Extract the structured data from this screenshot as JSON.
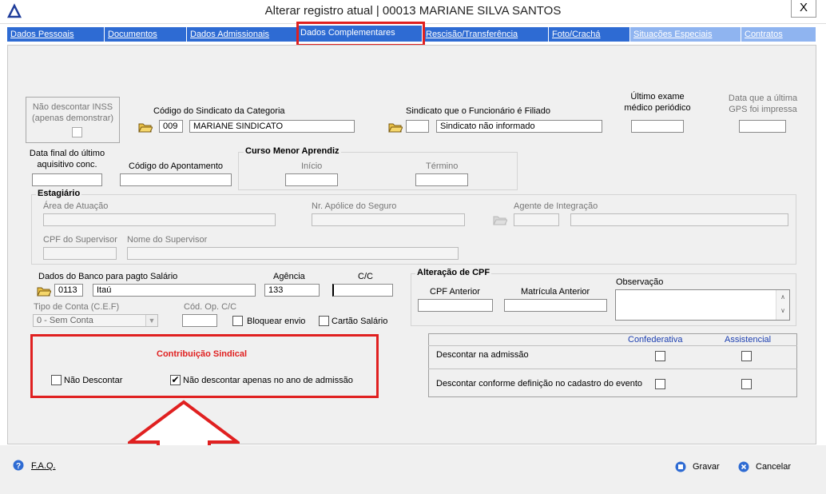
{
  "window": {
    "title": "Alterar registro atual | 00013 MARIANE SILVA SANTOS",
    "close": "X"
  },
  "tabs": [
    {
      "label": "Dados Pessoais"
    },
    {
      "label": "Documentos"
    },
    {
      "label": "Dados Admissionais"
    },
    {
      "label": "Dados Complementares"
    },
    {
      "label": "Rescisão/Transferência"
    },
    {
      "label": "Foto/Crachá"
    },
    {
      "label": "Situações Especiais"
    },
    {
      "label": "Contratos"
    }
  ],
  "inss": {
    "label_line1": "Não descontar INSS",
    "label_line2": "(apenas demonstrar)"
  },
  "sindicato_categoria": {
    "label": "Código do Sindicato da Categoria",
    "code": "009",
    "name": "MARIANE SINDICATO"
  },
  "sindicato_filiado": {
    "label": "Sindicato que o Funcionário é Filiado",
    "code": "",
    "name": "Sindicato não informado"
  },
  "ultimo_exame": {
    "label": "Último exame médico periódico",
    "value": ""
  },
  "gps": {
    "label": "Data que a última GPS foi impressa",
    "value": ""
  },
  "aquisitivo": {
    "label": "Data final do último aquisitivo conc.",
    "value": ""
  },
  "apontamento": {
    "label": "Código do Apontamento",
    "value": ""
  },
  "curso": {
    "title": "Curso Menor Aprendiz",
    "inicio_label": "Início",
    "termino_label": "Término"
  },
  "estagiario": {
    "title": "Estagiário",
    "area_label": "Área de Atuação",
    "apolice_label": "Nr. Apólice do Seguro",
    "agente_label": "Agente de Integração",
    "cpf_sup_label": "CPF do Supervisor",
    "nome_sup_label": "Nome do Supervisor"
  },
  "banco": {
    "label": "Dados do Banco para pagto Salário",
    "code": "0113",
    "name": "Itaú",
    "agencia_label": "Agência",
    "agencia": "133",
    "cc_label": "C/C",
    "cc": ""
  },
  "tipo_conta": {
    "label": "Tipo de Conta (C.E.F)",
    "value": "0 - Sem Conta",
    "cod_op_label": "Cód. Op. C/C",
    "bloquear_label": "Bloquear envio",
    "cartao_label": "Cartão Salário"
  },
  "cpf_alt": {
    "title": "Alteração de CPF",
    "anterior_label": "CPF Anterior",
    "matricula_label": "Matrícula Anterior",
    "obs_label": "Observação"
  },
  "contribuicao": {
    "title": "Contribuição Sindical",
    "nao_descontar": "Não Descontar",
    "nao_descontar_admissao": "Não descontar apenas no ano de admissão",
    "checked_mark": "✔"
  },
  "descontos": {
    "col1": "Confederativa",
    "col2": "Assistencial",
    "row1": "Descontar na admissão",
    "row2": "Descontar conforme definição no cadastro do evento"
  },
  "footer": {
    "faq": "F.A.Q.",
    "gravar": "Gravar",
    "cancelar": "Cancelar"
  },
  "colors": {
    "tab_blue": "#2e6bd3",
    "highlight_red": "#e02020"
  }
}
